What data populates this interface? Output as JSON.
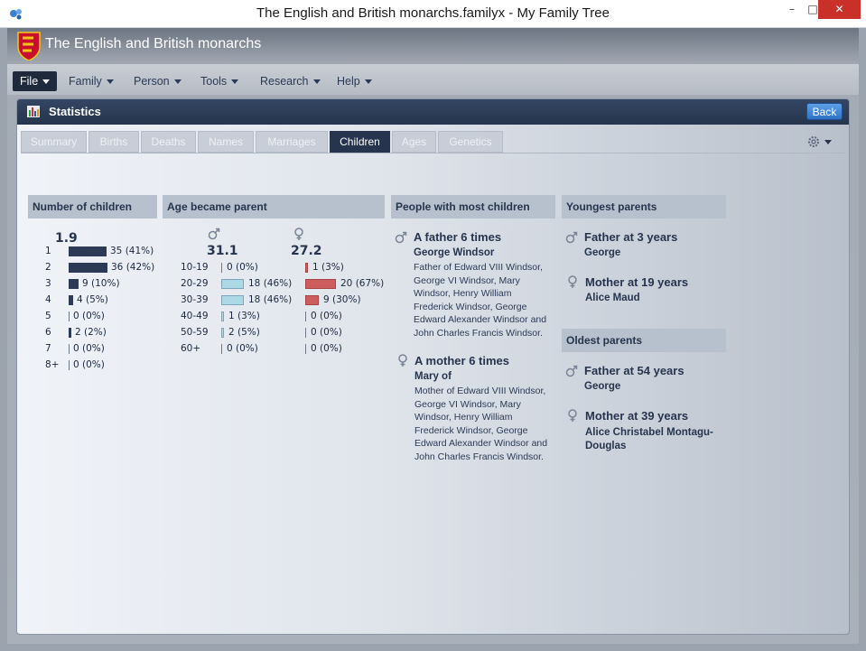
{
  "window": {
    "title": "The English and British monarchs.familyx - My Family Tree"
  },
  "app": {
    "title": "The English and British monarchs"
  },
  "menu": [
    "File",
    "Family",
    "Person",
    "Tools",
    "Research",
    "Help"
  ],
  "panel": {
    "title": "Statistics",
    "back_label": "Back"
  },
  "tabs": [
    "Summary",
    "Births",
    "Deaths",
    "Names",
    "Marriages",
    "Children",
    "Ages",
    "Genetics"
  ],
  "active_tab": "Children",
  "colors": {
    "dark_bar": "#2c3a55",
    "male_bar": "#add8e6",
    "female_bar": "#cd5c5c",
    "panel_header": "#26354d"
  },
  "num_children": {
    "heading": "Number of children",
    "average": "1.9",
    "rows": [
      {
        "label": "1",
        "count": 35,
        "pct": 41,
        "text": "35 (41%)"
      },
      {
        "label": "2",
        "count": 36,
        "pct": 42,
        "text": "36 (42%)"
      },
      {
        "label": "3",
        "count": 9,
        "pct": 10,
        "text": "9 (10%)"
      },
      {
        "label": "4",
        "count": 4,
        "pct": 5,
        "text": "4 (5%)"
      },
      {
        "label": "5",
        "count": 0,
        "pct": 0,
        "text": "0 (0%)"
      },
      {
        "label": "6",
        "count": 2,
        "pct": 2,
        "text": "2 (2%)"
      },
      {
        "label": "7",
        "count": 0,
        "pct": 0,
        "text": "0 (0%)"
      },
      {
        "label": "8+",
        "count": 0,
        "pct": 0,
        "text": "0 (0%)"
      }
    ]
  },
  "age_parent": {
    "heading": "Age became parent",
    "male_avg": "31.1",
    "female_avg": "27.2",
    "rows": [
      {
        "label": "10-19",
        "male": 0,
        "male_text": "0 (0%)",
        "female": 1,
        "female_text": "1 (3%)"
      },
      {
        "label": "20-29",
        "male": 18,
        "male_text": "18 (46%)",
        "female": 20,
        "female_text": "20 (67%)"
      },
      {
        "label": "30-39",
        "male": 18,
        "male_text": "18 (46%)",
        "female": 9,
        "female_text": "9 (30%)"
      },
      {
        "label": "40-49",
        "male": 1,
        "male_text": "1 (3%)",
        "female": 0,
        "female_text": "0 (0%)"
      },
      {
        "label": "50-59",
        "male": 2,
        "male_text": "2 (5%)",
        "female": 0,
        "female_text": "0 (0%)"
      },
      {
        "label": "60+",
        "male": 0,
        "male_text": "0 (0%)",
        "female": 0,
        "female_text": "0 (0%)"
      }
    ]
  },
  "most_children": {
    "heading": "People with most children",
    "father": {
      "title": "A father 6 times",
      "name": "George Windsor",
      "desc": "Father of Edward VIII Windsor, George VI Windsor, Mary Windsor, Henry William Frederick Windsor, George Edward Alexander Windsor and John Charles Francis Windsor."
    },
    "mother": {
      "title": "A mother 6 times",
      "name": "Mary of",
      "desc": "Mother of Edward VIII Windsor, George VI Windsor, Mary Windsor, Henry William Frederick Windsor, George Edward Alexander Windsor and John Charles Francis Windsor."
    }
  },
  "youngest": {
    "heading": "Youngest parents",
    "father_title": "Father at 3 years",
    "father_name": "George",
    "mother_title": "Mother at 19 years",
    "mother_name": "Alice Maud"
  },
  "oldest": {
    "heading": "Oldest parents",
    "father_title": "Father at 54 years",
    "father_name": "George",
    "mother_title": "Mother at 39 years",
    "mother_name": "Alice Christabel Montagu-Douglas"
  },
  "icons": {
    "male": "male-symbol",
    "female": "female-symbol",
    "gear": "gear-icon",
    "statistics": "bar-chart-icon",
    "crest": "royal-crest"
  }
}
